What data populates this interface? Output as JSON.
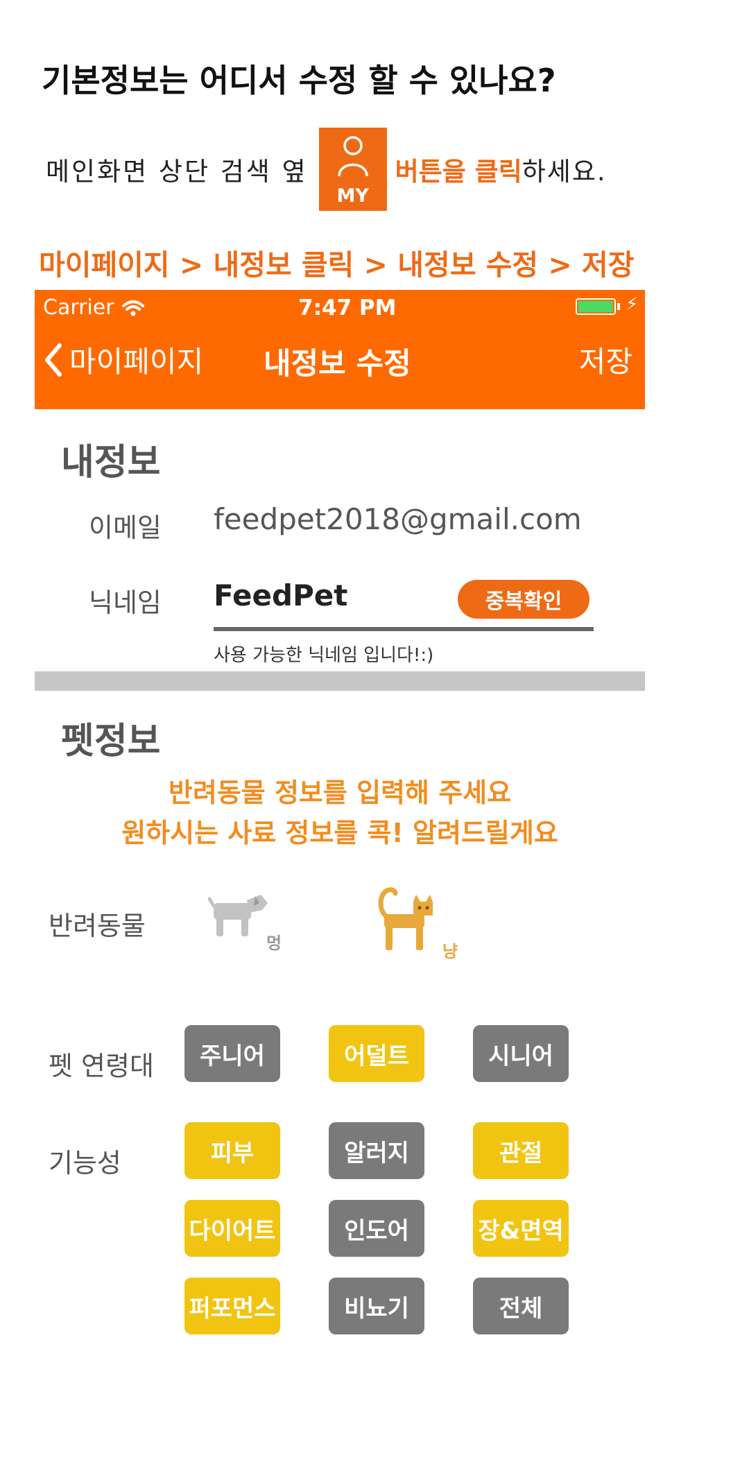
{
  "faq": {
    "title": "기본정보는 어디서 수정 할 수 있나요?",
    "instruction_pre": "메인화면 상단 검색 옆",
    "my_button_label": "MY",
    "instruction_highlight": "버튼을 클릭",
    "instruction_post": "하세요.",
    "path": "마이페이지 > 내정보 클릭 > 내정보 수정 > 저장"
  },
  "status_bar": {
    "carrier": "Carrier",
    "time": "7:47 PM"
  },
  "nav": {
    "back_label": "마이페이지",
    "title": "내정보 수정",
    "save_label": "저장"
  },
  "my_info": {
    "heading": "내정보",
    "email_label": "이메일",
    "email_value": "feedpet2018@gmail.com",
    "nickname_label": "닉네임",
    "nickname_value": "FeedPet",
    "dup_check_label": "중복확인",
    "nickname_message": "사용 가능한 닉네임 입니다!:)"
  },
  "pet_info": {
    "heading": "펫정보",
    "message_line1": "반려동물 정보를 입력해 주세요",
    "message_line2": "원하시는 사료 정보를 콕! 알려드릴게요",
    "pet_label": "반려동물",
    "dog_label": "멍",
    "cat_label": "냥",
    "selected_pet": "cat",
    "age_label": "펫 연령대",
    "age_options": [
      {
        "label": "주니어",
        "selected": false
      },
      {
        "label": "어덜트",
        "selected": true
      },
      {
        "label": "시니어",
        "selected": false
      }
    ],
    "function_label": "기능성",
    "function_options": [
      {
        "label": "피부",
        "selected": true
      },
      {
        "label": "알러지",
        "selected": false
      },
      {
        "label": "관절",
        "selected": true
      },
      {
        "label": "다이어트",
        "selected": true
      },
      {
        "label": "인도어",
        "selected": false
      },
      {
        "label": "장&면역",
        "selected": true
      },
      {
        "label": "퍼포먼스",
        "selected": true
      },
      {
        "label": "비뇨기",
        "selected": false
      },
      {
        "label": "전체",
        "selected": false
      }
    ]
  },
  "colors": {
    "brand_orange": "#ff6a00",
    "accent_orange": "#ef6a14",
    "chip_selected": "#f2c412",
    "chip_unselected": "#7a7a7a",
    "cat_icon": "#e8a83a",
    "dog_icon": "#c2c2c2"
  }
}
